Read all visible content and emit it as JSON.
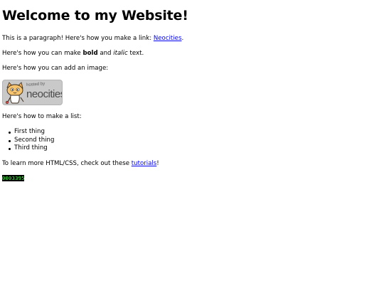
{
  "page": {
    "title": "Welcome to my Website!",
    "para_link": {
      "before": "This is a paragraph! Here's how you make a link: ",
      "link_text": "Neocities",
      "after": "."
    },
    "para_format": {
      "before": "Here's how you can make ",
      "bold": "bold",
      "middle": " and ",
      "italic": "italic",
      "after": " text."
    },
    "para_image": "Here's how you can add an image:",
    "badge": {
      "hosted_text": "hosted by",
      "brand_text": "neocities",
      "icon": "neocities-cat-icon"
    },
    "para_list": "Here's how to make a list:",
    "list_items": [
      "First thing",
      "Second thing",
      "Third thing"
    ],
    "para_learn": {
      "before": "To learn more HTML/CSS, check out these ",
      "link_text": "tutorials",
      "after": "!"
    },
    "hit_counter": "0003395"
  },
  "colors": {
    "link": "#0000ee",
    "counter_bg": "#000000",
    "counter_fg": "#4aff4a",
    "badge_bg": "#c9c9c9"
  }
}
